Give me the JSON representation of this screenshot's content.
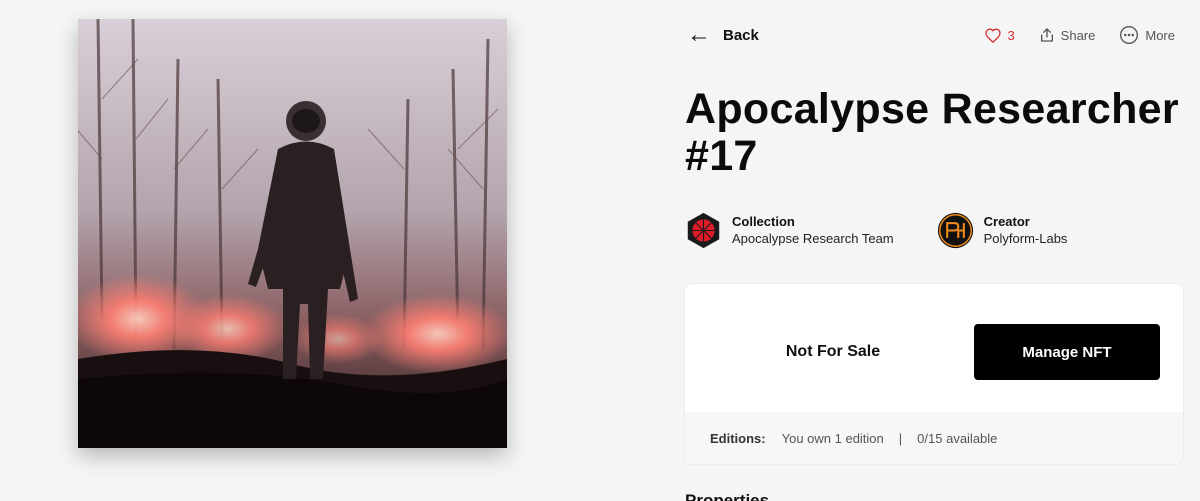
{
  "artwork": {
    "alt": "Apocalypse Researcher #17"
  },
  "topbar": {
    "back_label": "Back",
    "like_count": "3",
    "share_label": "Share",
    "more_label": "More"
  },
  "title": {
    "line1": "Apocalypse Researcher",
    "line2": "#17"
  },
  "collection": {
    "label": "Collection",
    "name": "Apocalypse Research Team"
  },
  "creator": {
    "label": "Creator",
    "name": "Polyform-Labs"
  },
  "sale": {
    "status": "Not For Sale",
    "manage_label": "Manage NFT"
  },
  "editions": {
    "label": "Editions:",
    "owned": "You own 1 edition",
    "separator": "|",
    "available": "0/15 available"
  },
  "next_section": {
    "title": "Properties"
  },
  "colors": {
    "like": "#d62f2f",
    "collection_avatar": "#e01b2a",
    "creator_avatar": "#f28c1a",
    "primary_button": "#000000"
  },
  "icons": [
    "back-arrow-icon",
    "heart-icon",
    "share-icon",
    "more-icon"
  ]
}
